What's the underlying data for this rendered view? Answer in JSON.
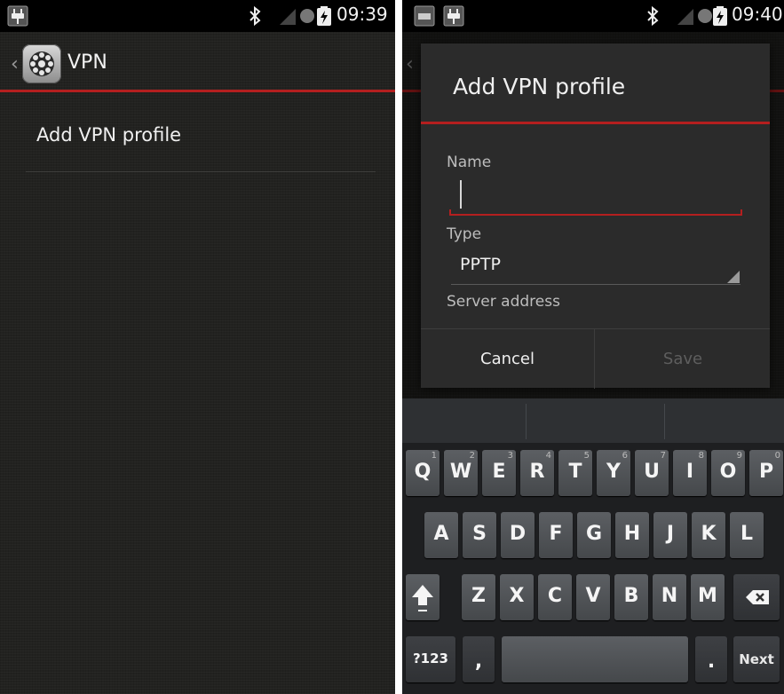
{
  "left": {
    "status_time": "09:39",
    "title": "VPN",
    "item": "Add VPN profile"
  },
  "right": {
    "status_time": "09:40",
    "dialog": {
      "title": "Add VPN profile",
      "name_label": "Name",
      "name_value": "",
      "type_label": "Type",
      "type_value": "PPTP",
      "server_label": "Server address",
      "cancel": "Cancel",
      "save": "Save"
    },
    "keyboard": {
      "row1": [
        {
          "k": "Q",
          "h": "1"
        },
        {
          "k": "W",
          "h": "2"
        },
        {
          "k": "E",
          "h": "3"
        },
        {
          "k": "R",
          "h": "4"
        },
        {
          "k": "T",
          "h": "5"
        },
        {
          "k": "Y",
          "h": "6"
        },
        {
          "k": "U",
          "h": "7"
        },
        {
          "k": "I",
          "h": "8"
        },
        {
          "k": "O",
          "h": "9"
        },
        {
          "k": "P",
          "h": "0"
        }
      ],
      "row2": [
        "A",
        "S",
        "D",
        "F",
        "G",
        "H",
        "J",
        "K",
        "L"
      ],
      "row3": [
        "Z",
        "X",
        "C",
        "V",
        "B",
        "N",
        "M"
      ],
      "sym": "?123",
      "comma": ",",
      "period": ".",
      "next": "Next"
    }
  },
  "colors": {
    "accent": "#b41f1f",
    "background": "#222220",
    "status_bar": "#000000"
  }
}
